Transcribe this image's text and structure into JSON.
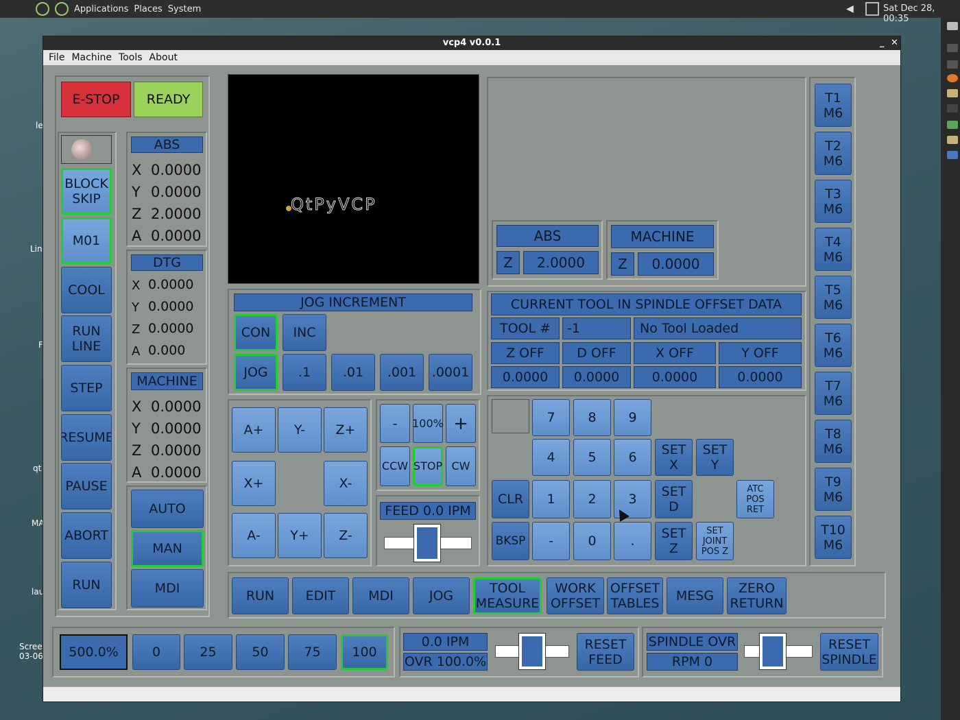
{
  "desktop": {
    "menu": [
      "Applications",
      "Places",
      "System"
    ],
    "clock": "Sat Dec 28, 00:35",
    "icon_labels": [
      "le",
      "Lin",
      "F",
      "qt",
      "MA",
      "lau",
      "Scree",
      "03-06"
    ]
  },
  "window": {
    "title": "vcp4 v0.0.1",
    "menu": [
      "File",
      "Machine",
      "Tools",
      "About"
    ]
  },
  "left": {
    "estop": "E-STOP",
    "ready": "READY",
    "buttons": [
      "BLOCK SKIP",
      "M01",
      "COOL",
      "RUN LINE",
      "STEP",
      "RESUME",
      "PAUSE",
      "ABORT",
      "RUN"
    ],
    "abs": {
      "title": "ABS",
      "rows": [
        [
          "X",
          "0.0000"
        ],
        [
          "Y",
          "0.0000"
        ],
        [
          "Z",
          "2.0000"
        ],
        [
          "A",
          "0.0000"
        ]
      ]
    },
    "dtg": {
      "title": "DTG",
      "rows": [
        [
          "X",
          "0.0000"
        ],
        [
          "Y",
          "0.0000"
        ],
        [
          "Z",
          "0.0000"
        ],
        [
          "A",
          "0.000"
        ]
      ]
    },
    "machine": {
      "title": "MACHINE",
      "rows": [
        [
          "X",
          "0.0000"
        ],
        [
          "Y",
          "0.0000"
        ],
        [
          "Z",
          "0.0000"
        ],
        [
          "A",
          "0.0000"
        ]
      ]
    },
    "modes": [
      "AUTO",
      "MAN",
      "MDI"
    ]
  },
  "preview": {
    "logo": "QtPyVCP"
  },
  "jog": {
    "title": "JOG INCREMENT",
    "row1": [
      "CON",
      "INC"
    ],
    "row2": [
      "JOG",
      ".1",
      ".01",
      ".001",
      ".0001"
    ],
    "axes": [
      "A+",
      "Y-",
      "Z+",
      "X+",
      "X-",
      "A-",
      "Y+",
      "Z-"
    ]
  },
  "spindle": {
    "minus": "-",
    "pct": "100%",
    "plus": "+",
    "ccw": "CCW",
    "stop": "STOP",
    "cw": "CW",
    "feed": "FEED 0.0  IPM"
  },
  "offsets": {
    "abs": "ABS",
    "machine": "MACHINE",
    "z": "Z",
    "abs_z": "2.0000",
    "mach_z": "0.0000",
    "tool_title": "CURRENT TOOL IN SPINDLE OFFSET DATA",
    "tool_label": "TOOL #",
    "tool_num": "-1",
    "tool_desc": "No Tool Loaded",
    "heads": [
      "Z OFF",
      "D OFF",
      "X OFF",
      "Y OFF"
    ],
    "vals": [
      "0.0000",
      "0.0000",
      "0.0000",
      "0.0000"
    ]
  },
  "keypad": {
    "keys": [
      "7",
      "8",
      "9",
      "4",
      "5",
      "6",
      "1",
      "2",
      "3",
      "-",
      "0",
      "."
    ],
    "clr": "CLR",
    "bksp": "BKSP",
    "setx": "SET X",
    "sety": "SET Y",
    "setd": "SET D",
    "setz": "SET Z",
    "setjoint": "SET JOINT POS Z",
    "atc": "ATC POS RET"
  },
  "tools": [
    "T1 M6",
    "T2 M6",
    "T3 M6",
    "T4 M6",
    "T5 M6",
    "T6 M6",
    "T7 M6",
    "T8 M6",
    "T9 M6",
    "T10 M6"
  ],
  "tabs": [
    "RUN",
    "EDIT",
    "MDI",
    "JOG",
    "TOOL MEASURE",
    "WORK OFFSET",
    "OFFSET TABLES",
    "MESG",
    "ZERO RETURN"
  ],
  "bottom": {
    "rapid": "500.0%",
    "rapid_btns": [
      "0",
      "25",
      "50",
      "75",
      "100"
    ],
    "feed_ipm": "0.0  IPM",
    "feed_ovr": "OVR 100.0%",
    "reset_feed": "RESET FEED",
    "spindle_ovr": "SPINDLE OVR",
    "rpm": "RPM 0",
    "reset_spindle": "RESET SPINDLE"
  },
  "colors": {
    "accent": "#3b6aae",
    "selected": "#22cc33",
    "estop": "#d7303b",
    "ready": "#9ad25a",
    "panel": "#8e9590"
  }
}
